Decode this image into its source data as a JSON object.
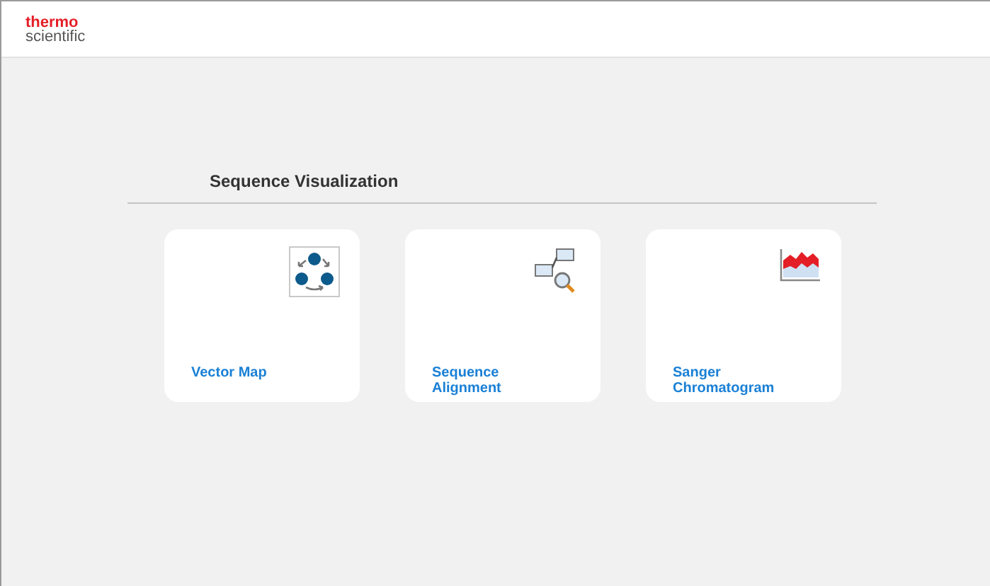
{
  "logo": {
    "line_1": "thermo",
    "line_2": "scientific"
  },
  "section": {
    "title": "Sequence Visualization"
  },
  "cards": [
    {
      "label": "Vector Map",
      "kind": "vector-map"
    },
    {
      "label": "Sequence Alignment",
      "kind": "alignment"
    },
    {
      "label": "Sanger Chromatogram",
      "kind": "chromatogram"
    }
  ]
}
